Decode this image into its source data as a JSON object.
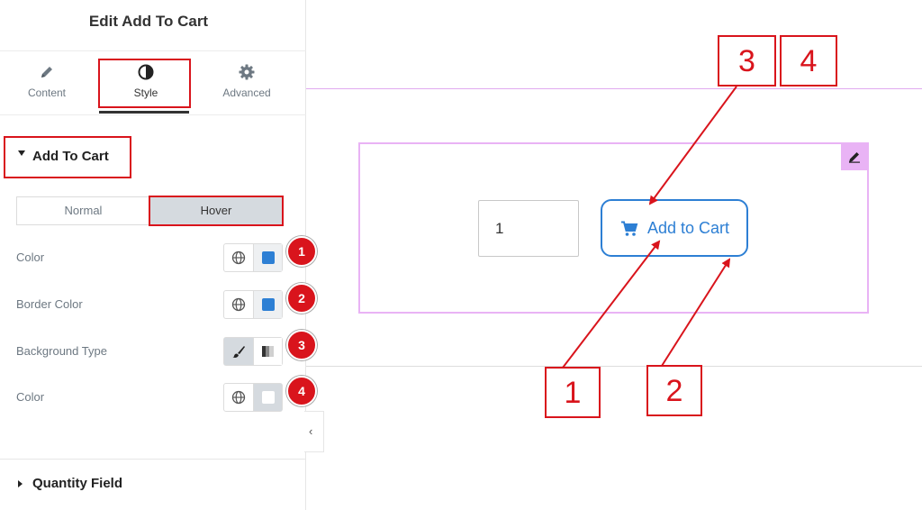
{
  "panel": {
    "title": "Edit Add To Cart",
    "tabs": [
      {
        "label": "Content",
        "icon": "pencil-icon"
      },
      {
        "label": "Style",
        "icon": "contrast-icon"
      },
      {
        "label": "Advanced",
        "icon": "gear-icon"
      }
    ],
    "section": {
      "title": "Add To Cart"
    },
    "state_tabs": {
      "normal": "Normal",
      "hover": "Hover"
    },
    "controls": [
      {
        "label": "Color",
        "badge": "1",
        "value_color": "#2d7fd4"
      },
      {
        "label": "Border Color",
        "badge": "2",
        "value_color": "#2d7fd4"
      },
      {
        "label": "Background Type",
        "badge": "3"
      },
      {
        "label": "Color",
        "badge": "4",
        "value_color": "#ffffff"
      }
    ],
    "collapse_icon": "‹",
    "next_section": {
      "title": "Quantity Field"
    }
  },
  "canvas": {
    "quantity_value": "1",
    "button_label": "Add to Cart",
    "button_icon": "cart-icon"
  },
  "callouts": {
    "one": "1",
    "two": "2",
    "three": "3",
    "four": "4"
  },
  "colors": {
    "accent": "#2d7fd4",
    "annotation": "#d9141c",
    "widget_outline": "#e9b3f5"
  }
}
